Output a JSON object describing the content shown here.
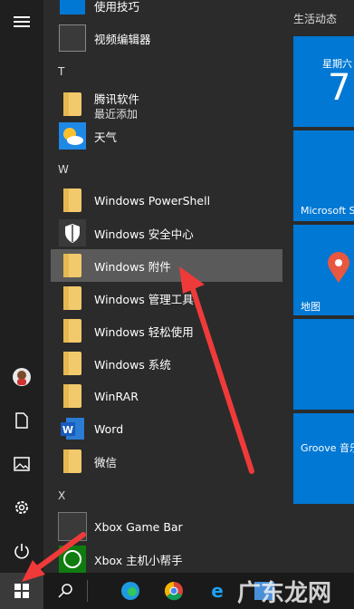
{
  "menu": {
    "top_partial_label": "使用技巧",
    "video_editor_label": "视频编辑器",
    "letter_t": "T",
    "tencent_label": "腾讯软件",
    "tencent_sub": "最近添加",
    "weather_label": "天气",
    "letter_w": "W",
    "powershell_label": "Windows PowerShell",
    "security_label": "Windows 安全中心",
    "accessories_label": "Windows 附件",
    "admin_tools_label": "Windows 管理工具",
    "ease_label": "Windows 轻松使用",
    "system_label": "Windows 系统",
    "winrar_label": "WinRAR",
    "word_label": "Word",
    "wechat_label": "微信",
    "letter_x": "X",
    "xbox_bar_label": "Xbox Game Bar",
    "xbox_companion_label": "Xbox 主机小帮手"
  },
  "tiles": {
    "header": "生活动态",
    "calendar_day": "星期六",
    "calendar_date": "7",
    "store_label": "Microsoft S",
    "maps_label": "地图",
    "groove_label": "Groove 音乐"
  },
  "watermark": "广东龙网",
  "icons": [
    "hamburger-icon",
    "user-avatar",
    "document-icon",
    "pictures-icon",
    "settings-icon",
    "power-icon",
    "windows-start-icon",
    "search-icon",
    "edge-icon",
    "chrome-icon",
    "ie-icon"
  ],
  "colors": {
    "tile_blue": "#0078d4",
    "folder": "#f2c96b",
    "arrow_red": "#f03a3a"
  }
}
